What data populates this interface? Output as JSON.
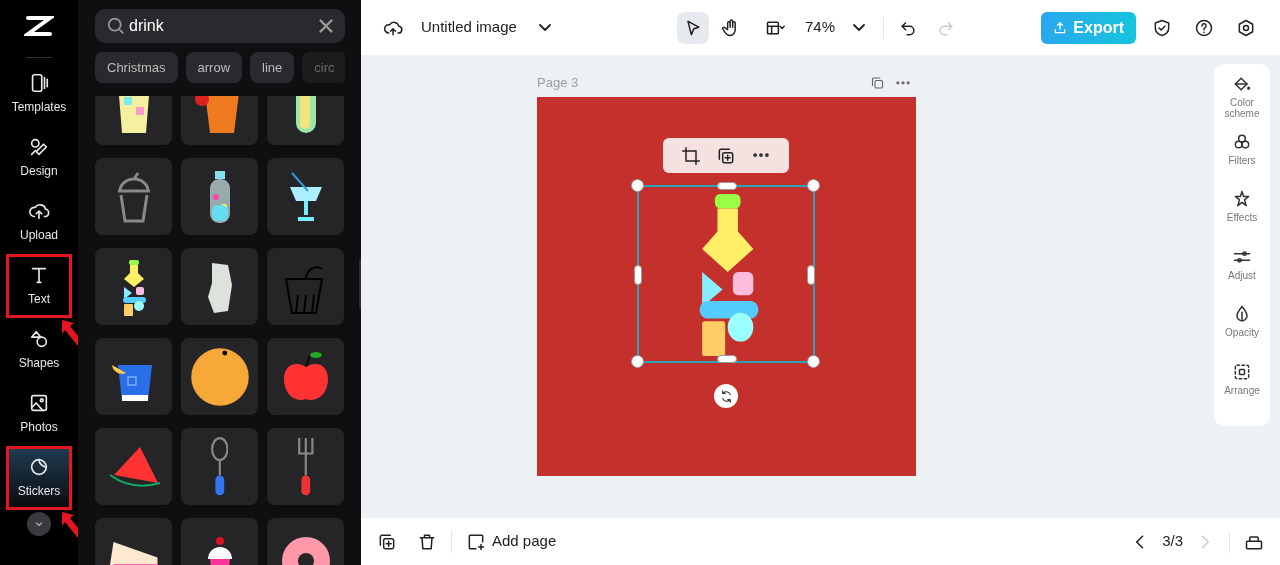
{
  "nav": {
    "items": [
      {
        "label": "Templates",
        "selected": false,
        "highlighted": false
      },
      {
        "label": "Design",
        "selected": false,
        "highlighted": false
      },
      {
        "label": "Upload",
        "selected": false,
        "highlighted": false
      },
      {
        "label": "Text",
        "selected": false,
        "highlighted": true
      },
      {
        "label": "Shapes",
        "selected": false,
        "highlighted": false
      },
      {
        "label": "Photos",
        "selected": false,
        "highlighted": false
      },
      {
        "label": "Stickers",
        "selected": true,
        "highlighted": true
      }
    ]
  },
  "search": {
    "value": "drink"
  },
  "chips": [
    "Christmas",
    "arrow",
    "line",
    "circ"
  ],
  "stickers": [
    {
      "kind": "juice"
    },
    {
      "kind": "mug"
    },
    {
      "kind": "capsule"
    },
    {
      "kind": "plastic-cup"
    },
    {
      "kind": "bottle"
    },
    {
      "kind": "cocktail"
    },
    {
      "kind": "shape-bottle"
    },
    {
      "kind": "rock"
    },
    {
      "kind": "sketch-cup"
    },
    {
      "kind": "lemon-glass"
    },
    {
      "kind": "orange"
    },
    {
      "kind": "apple"
    },
    {
      "kind": "watermelon"
    },
    {
      "kind": "spoon"
    },
    {
      "kind": "fork"
    },
    {
      "kind": "cake"
    },
    {
      "kind": "cupcake"
    },
    {
      "kind": "donut"
    }
  ],
  "header": {
    "title": "Untitled image",
    "tools": [
      {
        "kind": "select",
        "selected": true
      },
      {
        "kind": "hand",
        "selected": false
      }
    ],
    "zoom": "74%",
    "redo_disabled": true,
    "export": "Export"
  },
  "page": {
    "label": "Page 3",
    "element": {
      "kind": "shape-bottle",
      "selected": true
    }
  },
  "right_panel": [
    "Color scheme",
    "Filters",
    "Effects",
    "Adjust",
    "Opacity",
    "Arrange"
  ],
  "footer": {
    "add_page": "Add page",
    "pager": "3/3",
    "next_disabled": true
  }
}
